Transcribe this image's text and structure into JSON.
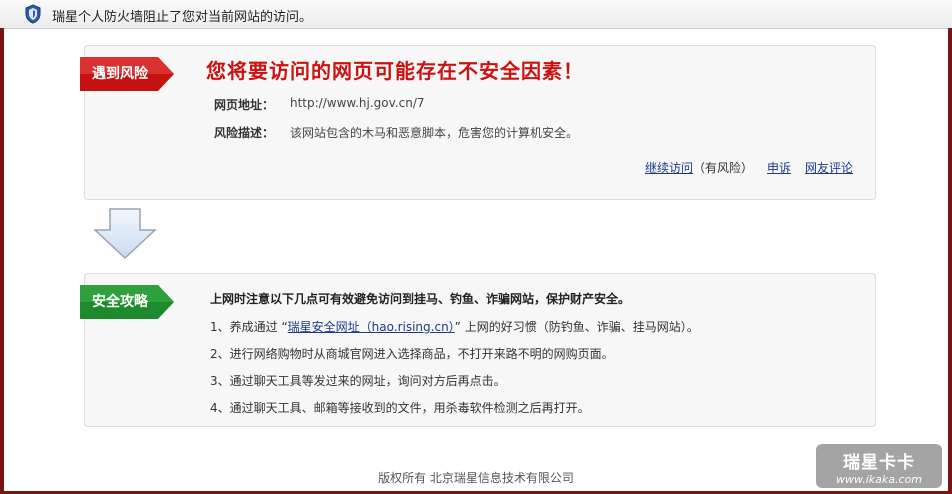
{
  "topbar": {
    "message": "瑞星个人防火墙阻止了您对当前网站的访问。",
    "icon": "shield-icon"
  },
  "risk": {
    "tag": "遇到风险",
    "title": "您将要访问的网页可能存在不安全因素！",
    "url_label": "网页地址：",
    "url_value": "http://www.hj.gov.cn/7",
    "desc_label": "风险描述：",
    "desc_value": "该网站包含的木马和恶意脚本，危害您的计算机安全。",
    "links": {
      "continue": "继续访问",
      "continue_note": "（有风险）",
      "appeal": "申诉",
      "comment": "网友评论"
    }
  },
  "tips": {
    "tag": "安全攻略",
    "heading": "上网时注意以下几点可有效避免访问到挂马、钓鱼、诈骗网站，保护财产安全。",
    "item1_prefix": "1、养成通过 “",
    "item1_link": "瑞星安全网址（hao.rising.cn）",
    "item1_suffix": "” 上网的好习惯（防钓鱼、诈骗、挂马网站）。",
    "item2": "2、进行网络购物时从商城官网进入选择商品，不打开来路不明的网购页面。",
    "item3": "3、通过聊天工具等发过来的网址，询问对方后再点击。",
    "item4": "4、通过聊天工具、邮箱等接收到的文件，用杀毒软件检测之后再打开。"
  },
  "footer": "版权所有 北京瑞星信息技术有限公司",
  "watermark": {
    "main": "瑞星卡卡",
    "sub": "www.ikaka.com"
  },
  "colors": {
    "risk_red": "#cc1111",
    "tag_red": "#c41212",
    "tag_green": "#1e8a2e",
    "link_blue": "#1d3a8a",
    "frame": "#7a1414"
  }
}
